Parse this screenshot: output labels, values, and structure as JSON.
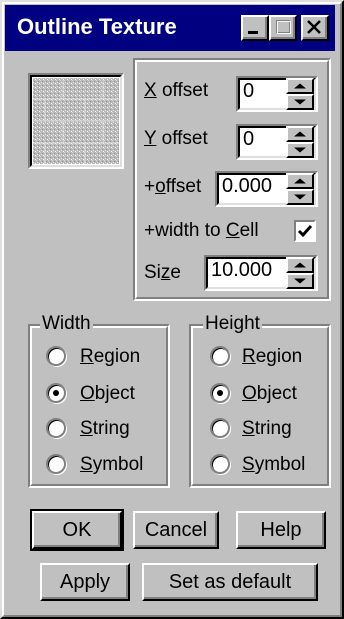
{
  "window": {
    "title": "Outline Texture"
  },
  "titlebar_buttons": {
    "minimize_icon": "minimize-icon",
    "maximize_icon": "maximize-icon",
    "close_icon": "close-icon"
  },
  "preview": {
    "icon": "brick-texture-icon"
  },
  "fields": {
    "x_offset": {
      "label_key": "X",
      "label_rest": " offset",
      "value": "0"
    },
    "y_offset": {
      "label_key": "Y",
      "label_rest": " offset",
      "value": "0"
    },
    "plus_offset": {
      "label_pre": "+",
      "label_key": "o",
      "label_rest": "ffset",
      "value": "0.000"
    },
    "width_to_cell": {
      "label_pre": "+width to ",
      "label_key": "C",
      "label_rest": "ell",
      "checked": true
    },
    "size": {
      "label_pre": "Si",
      "label_key": "z",
      "label_rest": "e",
      "value": "10.000"
    }
  },
  "width_group": {
    "caption": "Width",
    "options": [
      {
        "key": "R",
        "rest": "egion",
        "selected": false
      },
      {
        "key": "O",
        "rest": "bject",
        "selected": true
      },
      {
        "key": "S",
        "rest": "tring",
        "selected": false
      },
      {
        "key": "S",
        "rest": "ymbol",
        "selected": false
      }
    ]
  },
  "height_group": {
    "caption": "Height",
    "options": [
      {
        "key": "R",
        "rest": "egion",
        "selected": false
      },
      {
        "key": "O",
        "rest": "bject",
        "selected": true
      },
      {
        "key": "S",
        "rest": "tring",
        "selected": false
      },
      {
        "key": "S",
        "rest": "ymbol",
        "selected": false
      }
    ]
  },
  "buttons": {
    "ok": "OK",
    "cancel": "Cancel",
    "help": "Help",
    "apply": "Apply",
    "set_default": "Set as default"
  },
  "colors": {
    "face": "#c0c0c0",
    "titlebar": "#000080"
  }
}
